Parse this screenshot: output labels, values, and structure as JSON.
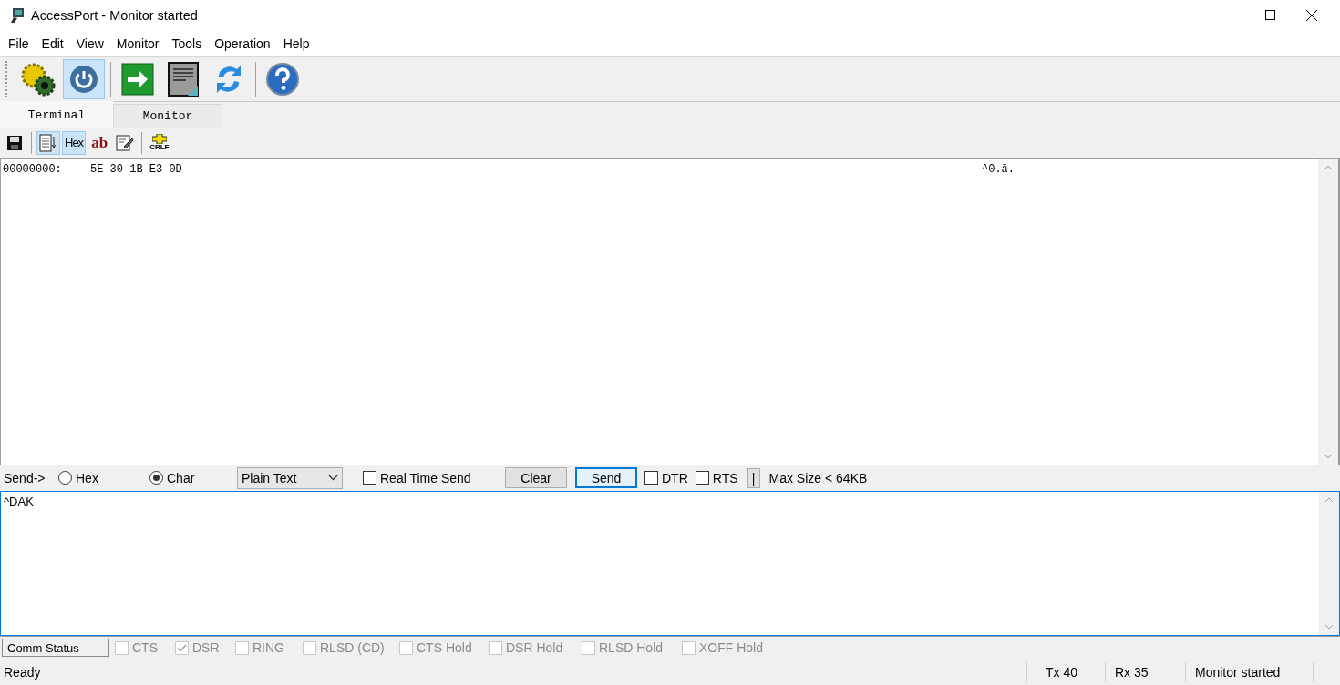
{
  "window": {
    "title": "AccessPort - Monitor  started"
  },
  "menu": [
    "File",
    "Edit",
    "View",
    "Monitor",
    "Tools",
    "Operation",
    "Help"
  ],
  "toolbar": [
    {
      "kind": "gears",
      "on": false
    },
    {
      "kind": "power",
      "on": true
    },
    {
      "kind": "arrow",
      "on": false
    },
    {
      "kind": "document",
      "on": false
    },
    {
      "kind": "refresh",
      "on": false
    },
    {
      "kind": "help",
      "on": false
    }
  ],
  "tabs": [
    {
      "label": "Terminal",
      "selected": true
    },
    {
      "label": "Monitor",
      "selected": false
    }
  ],
  "view_toolbar": [
    {
      "kind": "save",
      "on": false
    },
    {
      "kind": "scroll",
      "on": true
    },
    {
      "kind": "hex",
      "label": "Hex",
      "on": true
    },
    {
      "kind": "ab",
      "label": "ab",
      "on": false
    },
    {
      "kind": "edit",
      "on": false
    },
    {
      "kind": "crlf",
      "label": "CRLF",
      "on": false
    }
  ],
  "terminal": {
    "lines": [
      {
        "offset": "00000000:",
        "hex": "5E 30 1B E3 0D",
        "ascii": "^0.ã."
      }
    ]
  },
  "send_bar": {
    "label": "Send->",
    "radios": [
      {
        "label": "Hex",
        "selected": false
      },
      {
        "label": "Char",
        "selected": true
      }
    ],
    "format": {
      "value": "Plain Text"
    },
    "real_time_send": {
      "label": "Real Time Send",
      "checked": false
    },
    "buttons": [
      {
        "label": "Clear",
        "kind": "normal"
      },
      {
        "label": "Send",
        "kind": "default"
      }
    ],
    "lines": [
      {
        "label": "DTR",
        "checked": false
      },
      {
        "label": "RTS",
        "checked": false
      }
    ],
    "toggle": "|",
    "max_size": "Max Size < 64KB"
  },
  "input": {
    "value": "^DAK"
  },
  "comm_status": {
    "label": "Comm Status",
    "signals": [
      {
        "label": "CTS",
        "checked": false
      },
      {
        "label": "DSR",
        "checked": true
      },
      {
        "label": "RING",
        "checked": false
      },
      {
        "label": "RLSD (CD)",
        "checked": false
      },
      {
        "label": "CTS Hold",
        "checked": false
      },
      {
        "label": "DSR Hold",
        "checked": false
      },
      {
        "label": "RLSD Hold",
        "checked": false
      },
      {
        "label": "XOFF Hold",
        "checked": false
      }
    ]
  },
  "status_bar": {
    "message": "Ready",
    "tx": "Tx 40",
    "rx": "Rx 35",
    "state": "Monitor  started"
  }
}
